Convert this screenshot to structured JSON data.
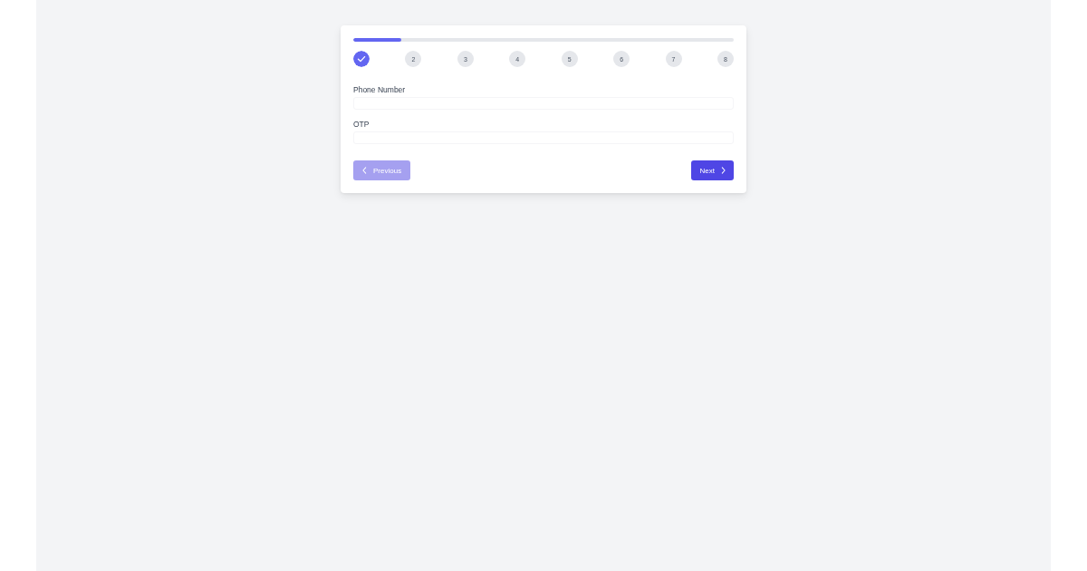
{
  "progress": {
    "level": 0.125
  },
  "steps": [
    {
      "completed": true
    },
    {
      "label": "2",
      "completed": false
    },
    {
      "label": "3",
      "completed": false
    },
    {
      "label": "4",
      "completed": false
    },
    {
      "label": "5",
      "completed": false
    },
    {
      "label": "6",
      "completed": false
    },
    {
      "label": "7",
      "completed": false
    },
    {
      "label": "8",
      "completed": false
    }
  ],
  "fields": [
    {
      "label": "Phone Number"
    },
    {
      "label": "OTP"
    }
  ],
  "buttons": [
    {
      "kind": "previous",
      "label": "Previous",
      "disabled": true
    },
    {
      "kind": "next",
      "label": "Next",
      "disabled": false
    }
  ]
}
